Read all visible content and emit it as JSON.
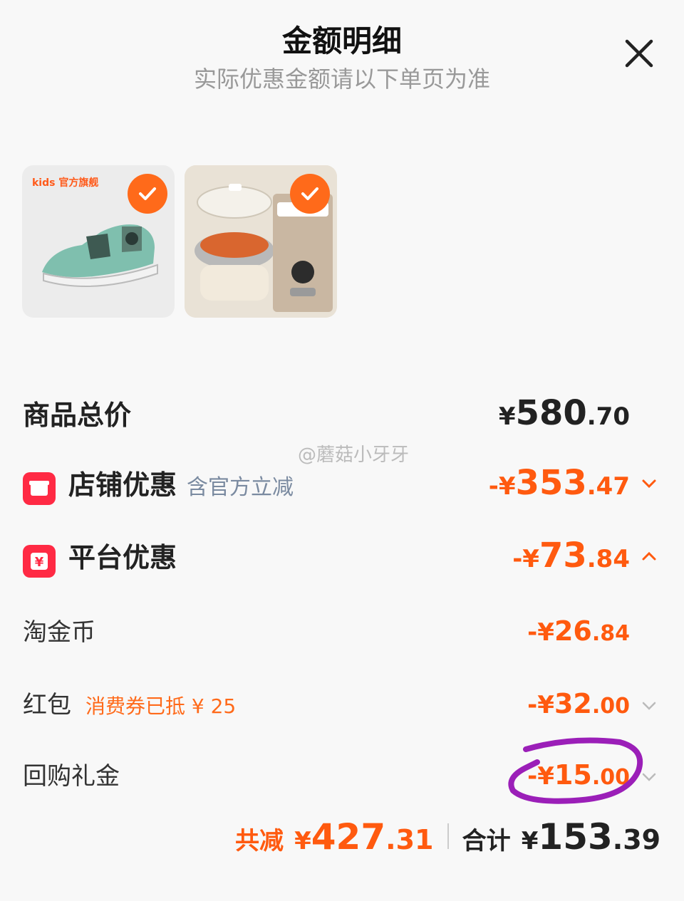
{
  "header": {
    "title": "金额明细",
    "subtitle": "实际优惠金额请以下单页为准"
  },
  "products": [
    {
      "brand": "kids 官方旗舰",
      "checked": true
    },
    {
      "checked": true
    }
  ],
  "summary": {
    "total": {
      "label": "商品总价",
      "currency": "¥",
      "int": "580",
      "dec": ".70"
    },
    "shop": {
      "label": "店铺优惠",
      "note": "含官方立减",
      "sign": "-¥",
      "int": "353",
      "dec": ".47",
      "expanded": false
    },
    "platform": {
      "label": "平台优惠",
      "sign": "-¥",
      "int": "73",
      "dec": ".84",
      "expanded": true
    },
    "coins": {
      "label": "淘金币",
      "sign": "-¥",
      "int": "26",
      "dec": ".84"
    },
    "redpack": {
      "label": "红包",
      "note": "消费券已抵 ¥ 25",
      "sign": "-¥",
      "int": "32",
      "dec": ".00"
    },
    "cashback": {
      "label": "回购礼金",
      "sign": "-¥",
      "int": "15",
      "dec": ".00"
    }
  },
  "watermark": "@蘑菇小牙牙",
  "footer": {
    "saved_label": "共减",
    "saved_currency": "¥",
    "saved_int": "427",
    "saved_dec": ".31",
    "total_label": "合计",
    "total_currency": "¥",
    "total_int": "153",
    "total_dec": ".39"
  },
  "colors": {
    "accent": "#ff5a0f",
    "badge": "#ff2a44",
    "annotation": "#9b1fb8"
  },
  "icons": [
    "close-icon",
    "check-icon",
    "shop-icon",
    "yen-icon",
    "chevron-down-icon",
    "chevron-up-icon"
  ]
}
